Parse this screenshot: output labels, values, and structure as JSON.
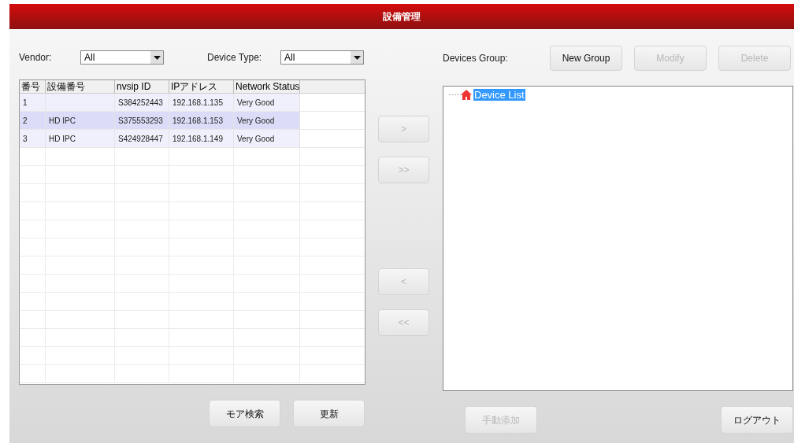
{
  "window": {
    "title": "設備管理"
  },
  "filters": [
    {
      "label": "Vendor:",
      "value": "All"
    },
    {
      "label": "Device Type:",
      "value": "All"
    }
  ],
  "table": {
    "columns": [
      "番号",
      "設備番号",
      "nvsip ID",
      "IPアドレス",
      "Network Status"
    ],
    "rows": [
      {
        "cells": [
          "1",
          "",
          "S384252443",
          "192.168.1.135",
          "Very Good"
        ],
        "selected": false
      },
      {
        "cells": [
          "2",
          "HD IPC",
          "S375553293",
          "192.168.1.153",
          "Very Good"
        ],
        "selected": true
      },
      {
        "cells": [
          "3",
          "HD IPC",
          "S424928447",
          "192.168.1.149",
          "Very Good"
        ],
        "selected": false
      }
    ]
  },
  "transfer_buttons": [
    {
      "label": ">",
      "disabled": true
    },
    {
      "label": ">>",
      "disabled": true
    },
    {
      "label": "<",
      "disabled": true
    },
    {
      "label": "<<",
      "disabled": true
    }
  ],
  "group": {
    "label": "Devices Group:",
    "buttons": [
      {
        "label": "New Group",
        "disabled": false
      },
      {
        "label": "Modify",
        "disabled": true
      },
      {
        "label": "Delete",
        "disabled": true
      }
    ],
    "tree": [
      {
        "label": "Device List",
        "selected": true
      }
    ]
  },
  "bottom_buttons": [
    {
      "label": "モア検索",
      "disabled": false
    },
    {
      "label": "更新",
      "disabled": false
    },
    {
      "label": "手動添加",
      "disabled": true
    },
    {
      "label": "ログアウト",
      "disabled": false
    }
  ]
}
